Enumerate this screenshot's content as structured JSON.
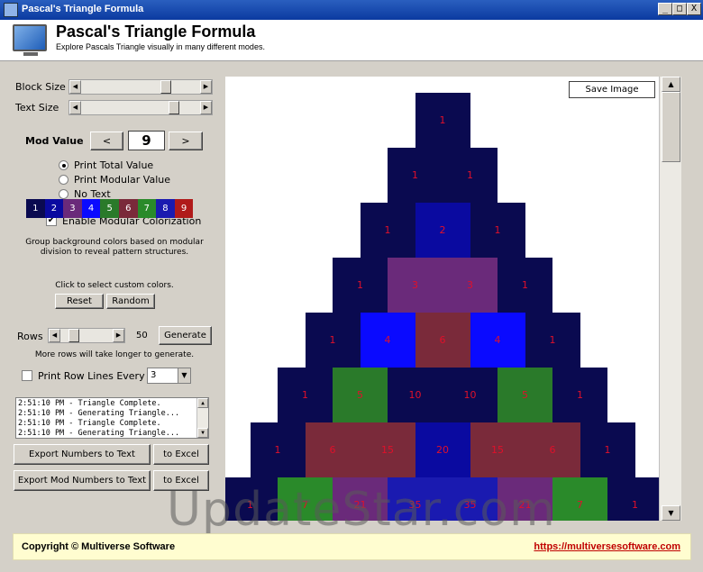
{
  "window": {
    "title": "Pascal's Triangle Formula",
    "min": "_",
    "max": "□",
    "close": "X"
  },
  "header": {
    "title": "Pascal's Triangle Formula",
    "subtitle": "Explore Pascals Triangle visually in many different modes."
  },
  "controls": {
    "block_size_label": "Block Size",
    "text_size_label": "Text Size",
    "mod_value_label": "Mod Value",
    "mod_prev": "<",
    "mod_value": "9",
    "mod_next": ">",
    "print_options": [
      "Print Total Value",
      "Print Modular Value",
      "No Text"
    ],
    "print_selected": 0,
    "enable_colorization_label": "Enable Modular Colorization",
    "enable_colorization": true,
    "group_text": "Group background colors based on modular division to reveal pattern structures.",
    "color_swatches": [
      {
        "label": "1",
        "color": "#0a0a50"
      },
      {
        "label": "2",
        "color": "#0a0aa0"
      },
      {
        "label": "3",
        "color": "#6a2a7a"
      },
      {
        "label": "4",
        "color": "#0a0aff"
      },
      {
        "label": "5",
        "color": "#2a7a2a"
      },
      {
        "label": "6",
        "color": "#7a2a3a"
      },
      {
        "label": "7",
        "color": "#2a8a2a"
      },
      {
        "label": "8",
        "color": "#1a1ab0"
      },
      {
        "label": "9",
        "color": "#b01a1a"
      }
    ],
    "custom_colors_hint": "Click to select custom colors.",
    "reset_label": "Reset",
    "random_label": "Random",
    "rows_label": "Rows",
    "rows_value": "50",
    "generate_label": "Generate",
    "rows_hint": "More rows will take longer to generate.",
    "print_row_lines_label": "Print Row Lines Every",
    "print_row_lines_checked": false,
    "print_row_lines_value": "3",
    "log_lines": [
      "2:51:10 PM - Triangle Complete.",
      "2:51:10 PM - Generating Triangle...",
      "2:51:10 PM - Triangle Complete.",
      "2:51:10 PM - Generating Triangle..."
    ],
    "export_numbers_label": "Export Numbers to Text",
    "export_numbers_excel_label": "to Excel",
    "export_mod_label": "Export Mod Numbers to Text",
    "export_mod_excel_label": "to Excel"
  },
  "canvas": {
    "save_image_label": "Save Image",
    "rows": [
      [
        {
          "v": "1",
          "c": "#0a0a50"
        }
      ],
      [
        {
          "v": "1",
          "c": "#0a0a50"
        },
        {
          "v": "1",
          "c": "#0a0a50"
        }
      ],
      [
        {
          "v": "1",
          "c": "#0a0a50"
        },
        {
          "v": "2",
          "c": "#0a0aa0"
        },
        {
          "v": "1",
          "c": "#0a0a50"
        }
      ],
      [
        {
          "v": "1",
          "c": "#0a0a50"
        },
        {
          "v": "3",
          "c": "#6a2a7a"
        },
        {
          "v": "3",
          "c": "#6a2a7a"
        },
        {
          "v": "1",
          "c": "#0a0a50"
        }
      ],
      [
        {
          "v": "1",
          "c": "#0a0a50"
        },
        {
          "v": "4",
          "c": "#0a0aff"
        },
        {
          "v": "6",
          "c": "#7a2a3a"
        },
        {
          "v": "4",
          "c": "#0a0aff"
        },
        {
          "v": "1",
          "c": "#0a0a50"
        }
      ],
      [
        {
          "v": "1",
          "c": "#0a0a50"
        },
        {
          "v": "5",
          "c": "#2a7a2a"
        },
        {
          "v": "10",
          "c": "#0a0a50"
        },
        {
          "v": "10",
          "c": "#0a0a50"
        },
        {
          "v": "5",
          "c": "#2a7a2a"
        },
        {
          "v": "1",
          "c": "#0a0a50"
        }
      ],
      [
        {
          "v": "1",
          "c": "#0a0a50"
        },
        {
          "v": "6",
          "c": "#7a2a3a"
        },
        {
          "v": "15",
          "c": "#7a2a3a"
        },
        {
          "v": "20",
          "c": "#0a0aa0"
        },
        {
          "v": "15",
          "c": "#7a2a3a"
        },
        {
          "v": "6",
          "c": "#7a2a3a"
        },
        {
          "v": "1",
          "c": "#0a0a50"
        }
      ],
      [
        {
          "v": "1",
          "c": "#0a0a50"
        },
        {
          "v": "7",
          "c": "#2a8a2a"
        },
        {
          "v": "21",
          "c": "#6a2a7a"
        },
        {
          "v": "35",
          "c": "#1a1ab0"
        },
        {
          "v": "35",
          "c": "#1a1ab0"
        },
        {
          "v": "21",
          "c": "#6a2a7a"
        },
        {
          "v": "7",
          "c": "#2a8a2a"
        },
        {
          "v": "1",
          "c": "#0a0a50"
        }
      ]
    ]
  },
  "watermark": "UpdateStar.com",
  "footer": {
    "copyright": "Copyright © Multiverse Software",
    "link": "https://multiversesoftware.com"
  }
}
